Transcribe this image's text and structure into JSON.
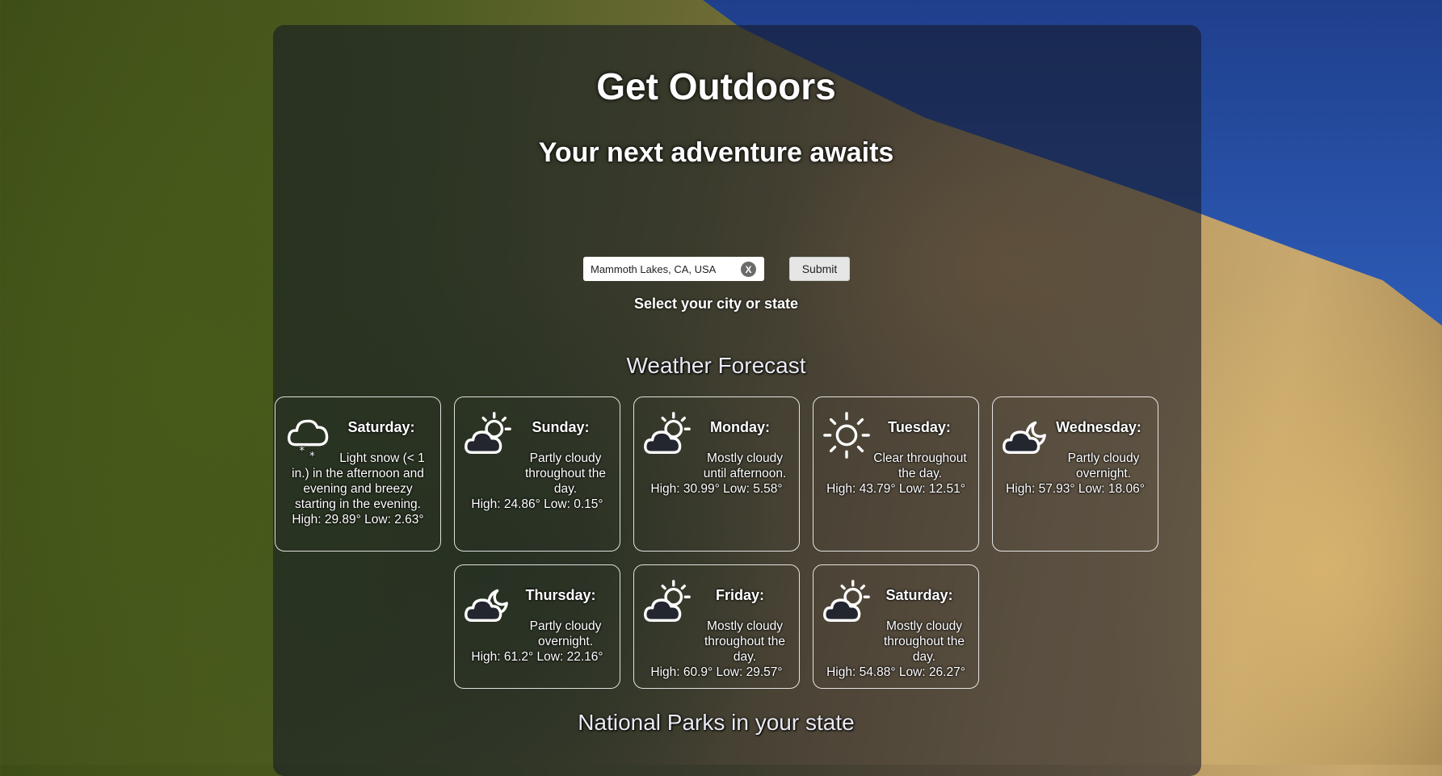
{
  "header": {
    "title": "Get Outdoors",
    "subtitle": "Your next adventure awaits"
  },
  "search": {
    "value": "Mammoth Lakes, CA, USA",
    "clear_label": "X",
    "submit_label": "Submit",
    "hint": "Select your city or state"
  },
  "weather": {
    "heading": "Weather Forecast",
    "days": [
      {
        "day": "Saturday:",
        "icon": "snow-cloud-icon",
        "desc": "Light snow (< 1 in.) in the afternoon and evening and breezy starting in the evening.",
        "temps": "High: 29.89° Low: 2.63°"
      },
      {
        "day": "Sunday:",
        "icon": "partly-cloudy-icon",
        "desc": "Partly cloudy throughout the day.",
        "temps": "High: 24.86° Low: 0.15°"
      },
      {
        "day": "Monday:",
        "icon": "partly-cloudy-icon",
        "desc": "Mostly cloudy until afternoon.",
        "temps": "High: 30.99° Low: 5.58°"
      },
      {
        "day": "Tuesday:",
        "icon": "sun-icon",
        "desc": "Clear throughout the day.",
        "temps": "High: 43.79° Low: 12.51°"
      },
      {
        "day": "Wednesday:",
        "icon": "partly-cloudy-night-icon",
        "desc": "Partly cloudy overnight.",
        "temps": "High: 57.93° Low: 18.06°"
      },
      {
        "day": "Thursday:",
        "icon": "partly-cloudy-night-icon",
        "desc": "Partly cloudy overnight.",
        "temps": "High: 61.2° Low: 22.16°"
      },
      {
        "day": "Friday:",
        "icon": "partly-cloudy-icon",
        "desc": "Mostly cloudy throughout the day.",
        "temps": "High: 60.9° Low: 29.57°"
      },
      {
        "day": "Saturday:",
        "icon": "partly-cloudy-icon",
        "desc": "Mostly cloudy throughout the day.",
        "temps": "High: 54.88° Low: 26.27°"
      }
    ]
  },
  "parks": {
    "heading": "National Parks in your state"
  }
}
